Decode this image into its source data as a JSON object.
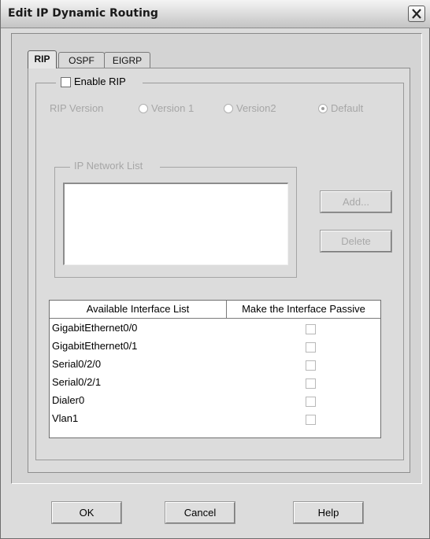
{
  "window": {
    "title": "Edit IP Dynamic Routing",
    "close_glyph": "✕"
  },
  "tabs": [
    {
      "label": "RIP",
      "active": true
    },
    {
      "label": "OSPF",
      "active": false
    },
    {
      "label": "EIGRP",
      "active": false
    }
  ],
  "rip": {
    "enable_label": "Enable RIP",
    "enable_checked": false,
    "version_label": "RIP Version",
    "version_options": [
      "Version 1",
      "Version2",
      "Default"
    ],
    "version_selected": "Default",
    "network_list_label": "IP Network List",
    "network_items": [],
    "add_button": "Add...",
    "delete_button": "Delete"
  },
  "interfaces": {
    "headers": [
      "Available Interface List",
      "Make the Interface Passive"
    ],
    "rows": [
      {
        "name": "GigabitEthernet0/0",
        "passive": false
      },
      {
        "name": "GigabitEthernet0/1",
        "passive": false
      },
      {
        "name": "Serial0/2/0",
        "passive": false
      },
      {
        "name": "Serial0/2/1",
        "passive": false
      },
      {
        "name": "Dialer0",
        "passive": false
      },
      {
        "name": "Vlan1",
        "passive": false
      }
    ]
  },
  "footer": {
    "ok": "OK",
    "cancel": "Cancel",
    "help": "Help"
  }
}
